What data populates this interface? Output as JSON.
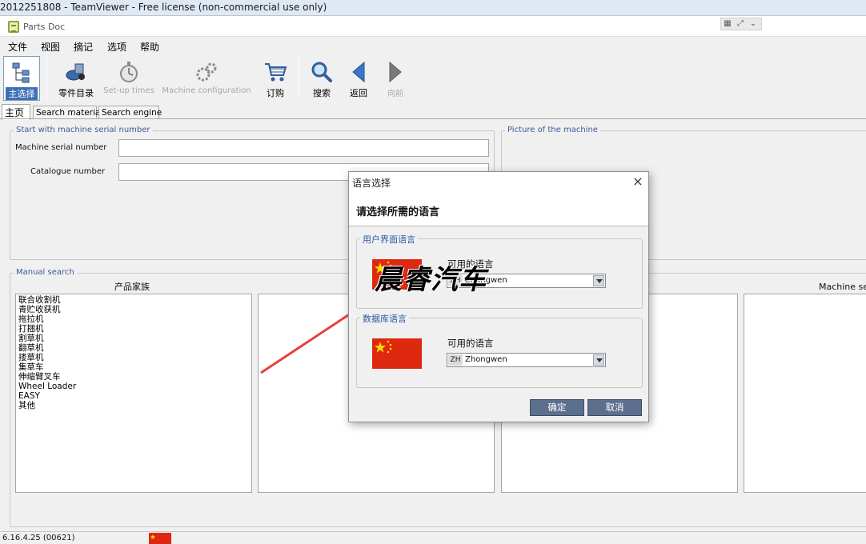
{
  "teamviewer": {
    "title": "2012251808 - TeamViewer - Free license (non-commercial use only)"
  },
  "app": {
    "title": "Parts Doc",
    "menu": [
      "文件",
      "视图",
      "摘记",
      "选项",
      "帮助"
    ],
    "toolbar": [
      {
        "label": "主选择",
        "icon": "tree-icon",
        "state": "active"
      },
      {
        "label": "零件目录",
        "icon": "parts-catalog-icon",
        "state": "enabled"
      },
      {
        "label": "Set-up times",
        "icon": "stopwatch-icon",
        "state": "disabled"
      },
      {
        "label": "Machine configuration",
        "icon": "gears-icon",
        "state": "disabled"
      },
      {
        "label": "订购",
        "icon": "shopping-cart-icon",
        "state": "enabled"
      },
      {
        "label": "搜索",
        "icon": "magnifier-icon",
        "state": "enabled"
      },
      {
        "label": "返回",
        "icon": "back-arrow-icon",
        "state": "enabled"
      },
      {
        "label": "向前",
        "icon": "forward-arrow-icon",
        "state": "disabled"
      }
    ],
    "tabs": [
      "主页",
      "Search material",
      "Search engine"
    ],
    "serial_group": {
      "legend": "Start with machine serial number",
      "machine_serial_label": "Machine serial number",
      "machine_serial_value": "",
      "catalogue_label": "Catalogue number",
      "catalogue_value": ""
    },
    "picture_group": {
      "legend": "Picture of the machine"
    },
    "manual_search": {
      "legend": "Manual search",
      "product_family_title": "产品家族",
      "product_family_items": [
        "联合收割机",
        "青贮收获机",
        "拖拉机",
        "打捆机",
        "割草机",
        "翻草机",
        "搂草机",
        "集草车",
        "伸缩臂叉车",
        "Wheel Loader",
        "EASY",
        "其他"
      ],
      "machine_series_title": "Machine seri"
    },
    "status": {
      "version": "6.16.4.25 (00621)"
    }
  },
  "dialog": {
    "title": "语言选择",
    "close": "×",
    "heading": "请选择所需的语言",
    "ui_language": {
      "legend": "用户界面语言",
      "available_label": "可用的语言",
      "code": "ZH",
      "value": "Zhongwen"
    },
    "db_language": {
      "legend": "数据库语言",
      "available_label": "可用的语言",
      "code": "ZH",
      "value": "Zhongwen"
    },
    "ok_label": "确定",
    "cancel_label": "取消"
  },
  "watermark": "晨睿汽车",
  "colors": {
    "flag_red": "#de2910",
    "flag_star": "#ffde00",
    "annotation_arrow": "#e8403f",
    "legend_blue": "#2e59a7",
    "dialog_button": "#5c6f8c"
  }
}
